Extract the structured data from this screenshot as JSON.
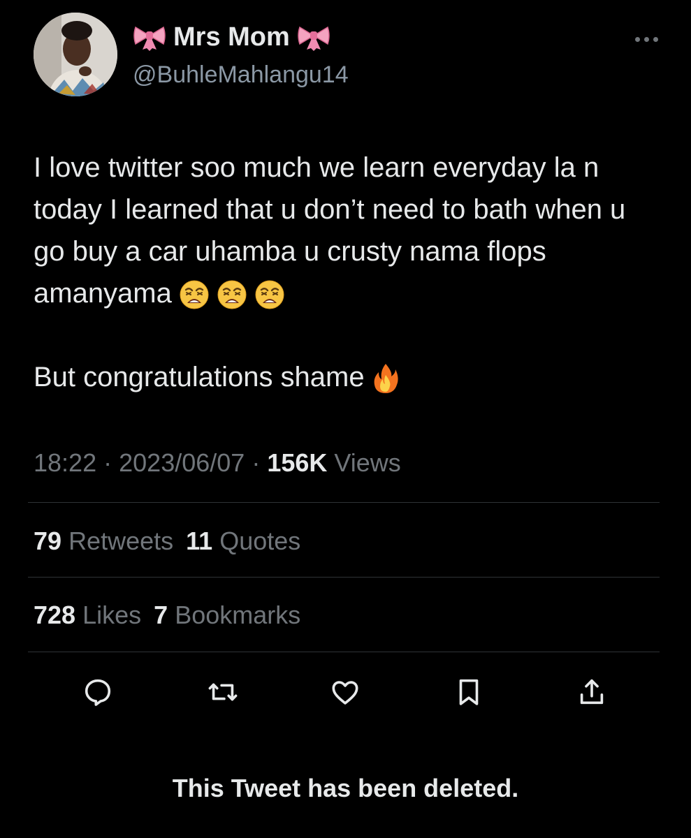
{
  "author": {
    "display_name": "Mrs Mom",
    "handle": "@BuhleMahlangu14",
    "avatar_icon": "profile-photo",
    "name_decoration_icon": "ribbon-emoji"
  },
  "tweet": {
    "paragraphs": [
      {
        "text": "I love twitter soo much we learn everyday la n today I learned that u don’t need to bath when u go buy a car uhamba u crusty nama flops amanyama",
        "emoji_icons": [
          "weary-face-emoji",
          "weary-face-emoji",
          "weary-face-emoji"
        ]
      },
      {
        "text": "But congratulations shame",
        "emoji_icons": [
          "fire-emoji"
        ]
      }
    ]
  },
  "meta": {
    "time": "18:22",
    "separator": "·",
    "date": "2023/06/07",
    "views_count": "156K",
    "views_label": "Views"
  },
  "stats": {
    "retweets_count": "79",
    "retweets_label": "Retweets",
    "quotes_count": "11",
    "quotes_label": "Quotes",
    "likes_count": "728",
    "likes_label": "Likes",
    "bookmarks_count": "7",
    "bookmarks_label": "Bookmarks"
  },
  "actions": [
    {
      "icon": "reply-icon"
    },
    {
      "icon": "retweet-icon"
    },
    {
      "icon": "like-icon"
    },
    {
      "icon": "bookmark-icon"
    },
    {
      "icon": "share-icon"
    }
  ],
  "notice": {
    "deleted_text": "This Tweet has been deleted."
  },
  "colors": {
    "background": "#000000",
    "primary_text": "#e7e9ea",
    "secondary_text": "#71767b",
    "divider": "#2f3336",
    "ribbon": "#f4a3c0"
  }
}
